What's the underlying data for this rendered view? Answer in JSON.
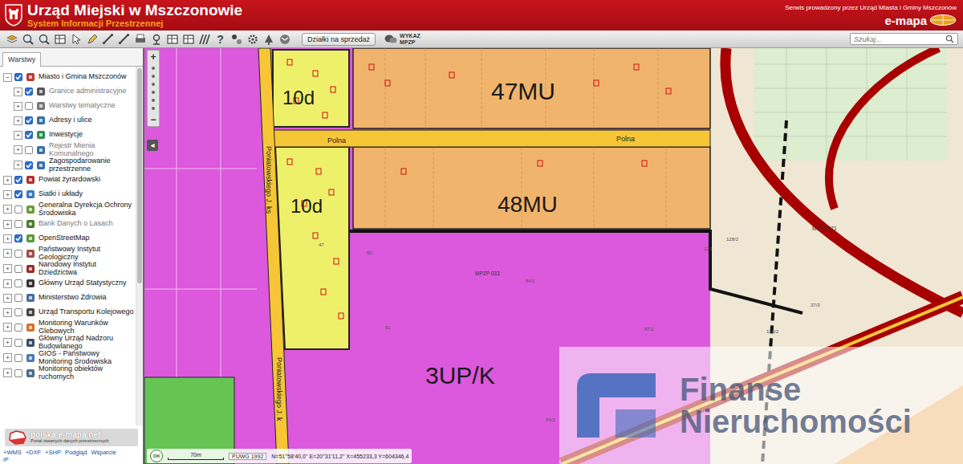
{
  "header": {
    "title": "Urząd Miejski w Mszczonowie",
    "subtitle": "System Informacji Przestrzennej",
    "operator": "Serwis prowadzony przez Urząd Miasta i Gminy Mszczonów",
    "brand": "e-mapa"
  },
  "toolbar": {
    "help": "?",
    "sale_button": "Działki na sprzedaż",
    "mpzp_label": [
      "WYKAZ",
      "MPZP"
    ],
    "search_placeholder": "Szukaj..."
  },
  "sidebar": {
    "tabs": [
      {
        "label": "Warstwy",
        "selected": true
      }
    ],
    "layers": [
      {
        "label": "Miasto i Gmina Mszczonów",
        "level": 0,
        "expander": "−",
        "checked": true,
        "dimmed": false
      },
      {
        "label": "Granice administracyjne",
        "level": 1,
        "expander": "+",
        "checked": true,
        "dimmed": true
      },
      {
        "label": "Warstwy tematyczne",
        "level": 1,
        "expander": "+",
        "checked": false,
        "dimmed": true
      },
      {
        "label": "Adresy i ulice",
        "level": 1,
        "expander": "+",
        "checked": true,
        "dimmed": false
      },
      {
        "label": "Inwestycje",
        "level": 1,
        "expander": "+",
        "checked": true,
        "dimmed": false
      },
      {
        "label": "Rejestr Mienia Komunalnego",
        "level": 1,
        "expander": "+",
        "checked": false,
        "dimmed": true
      },
      {
        "label": "Zagospodarowanie przestrzenne",
        "level": 1,
        "expander": "+",
        "checked": true,
        "dimmed": false
      },
      {
        "label": "Powiat żyrardowski",
        "level": 0,
        "expander": "+",
        "checked": true,
        "dimmed": false
      },
      {
        "label": "Siatki i układy",
        "level": 0,
        "expander": "+",
        "checked": true,
        "dimmed": false
      },
      {
        "label": "Generalna Dyrekcja Ochrony Środowiska",
        "level": 0,
        "expander": "+",
        "checked": false,
        "dimmed": false
      },
      {
        "label": "Bank Danych o Lasach",
        "level": 0,
        "expander": "+",
        "checked": false,
        "dimmed": true
      },
      {
        "label": "OpenStreetMap",
        "level": 0,
        "expander": "+",
        "checked": true,
        "dimmed": false
      },
      {
        "label": "Państwowy Instytut Geologiczny",
        "level": 0,
        "expander": "+",
        "checked": false,
        "dimmed": false
      },
      {
        "label": "Narodowy Instytut Dziedzictwa",
        "level": 0,
        "expander": "+",
        "checked": false,
        "dimmed": false
      },
      {
        "label": "Główny Urząd Statystyczny",
        "level": 0,
        "expander": "+",
        "checked": false,
        "dimmed": false
      },
      {
        "label": "Ministerstwo Zdrowia",
        "level": 0,
        "expander": "+",
        "checked": false,
        "dimmed": false
      },
      {
        "label": "Urząd Transportu Kolejowego",
        "level": 0,
        "expander": "+",
        "checked": false,
        "dimmed": false
      },
      {
        "label": "Monitoring Warunków Glebowych",
        "level": 0,
        "expander": "+",
        "checked": false,
        "dimmed": false
      },
      {
        "label": "Główny Urząd Nadzoru Budowlanego",
        "level": 0,
        "expander": "+",
        "checked": false,
        "dimmed": false
      },
      {
        "label": "GIOŚ - Państwowy Monitoring Środowiska",
        "level": 0,
        "expander": "+",
        "checked": false,
        "dimmed": false
      },
      {
        "label": "Monitoring obiektów ruchomych",
        "level": 0,
        "expander": "+",
        "checked": false,
        "dimmed": false
      }
    ],
    "portal": {
      "name": "polska.e-mapa.net",
      "tagline": "Portal otwartych danych przestrzennych"
    },
    "links": [
      "+WMS",
      "+DXF",
      "+SHP",
      "Podgląd",
      "Wsparcie"
    ],
    "footer": "IP"
  },
  "map": {
    "zoom_in": "+",
    "zoom_out": "−",
    "collapse": "◂",
    "zones": [
      "10d",
      "47MU",
      "10d",
      "48MU",
      "3UP/K"
    ],
    "streets": [
      "Polna",
      "Polna",
      "Poniatowskiego J. ks",
      "Poniatowskiego J. k"
    ],
    "plans": [
      "MPZP 033",
      "MPZP 071"
    ],
    "parcels": [
      "50",
      "47",
      "84/1",
      "87/2",
      "126/2",
      "128/2",
      "129",
      "51",
      "84/2",
      "37/3"
    ],
    "scale": "70m",
    "projection": "PUWG 1992",
    "coords": "N=51°58'40,0'' E=20°31'11,2'' X=455233,3 Y=604346,4",
    "ok": "OK",
    "watermark": [
      "Finanse",
      "Nieruchomości"
    ]
  }
}
